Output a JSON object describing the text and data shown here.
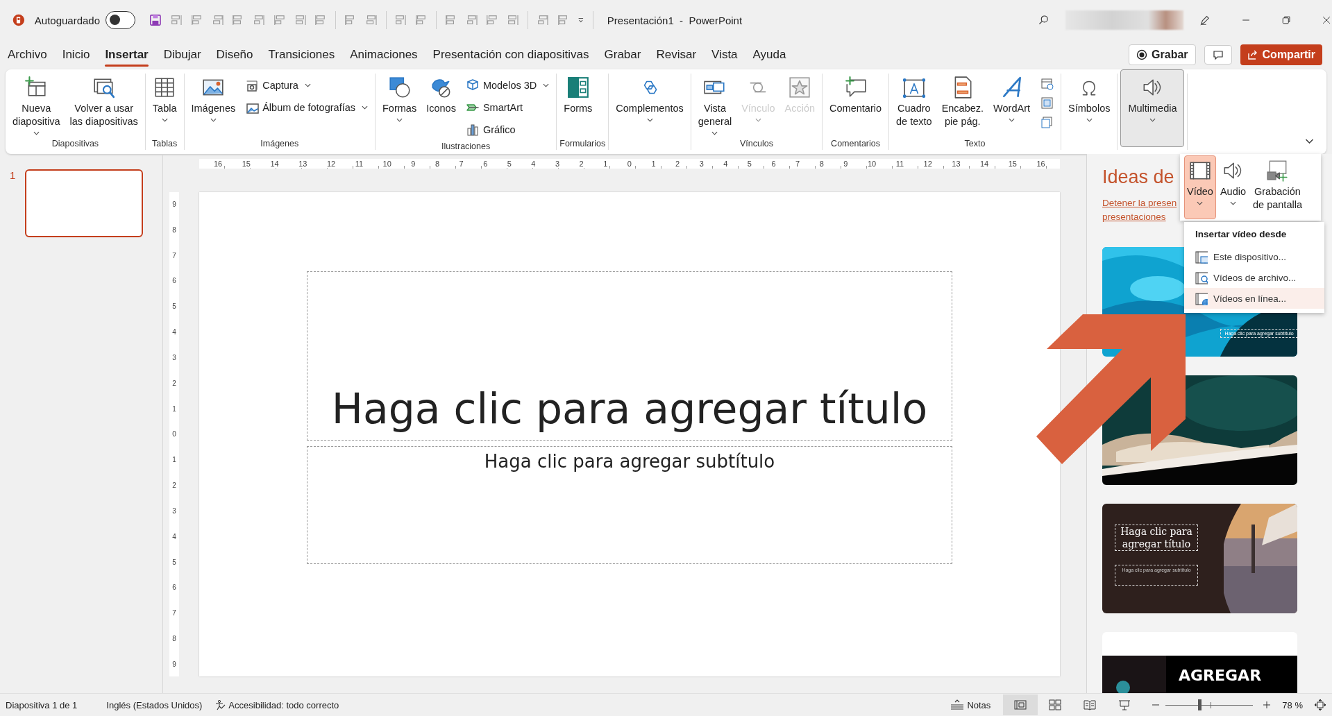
{
  "title_bar": {
    "autosave": {
      "label": "Autoguardado",
      "on": false
    },
    "document_title": "Presentación1  -  PowerPoint"
  },
  "menu_tabs": [
    {
      "label": "Archivo",
      "selected": false
    },
    {
      "label": "Inicio",
      "selected": false
    },
    {
      "label": "Insertar",
      "selected": true
    },
    {
      "label": "Dibujar",
      "selected": false
    },
    {
      "label": "Diseño",
      "selected": false
    },
    {
      "label": "Transiciones",
      "selected": false
    },
    {
      "label": "Animaciones",
      "selected": false
    },
    {
      "label": "Presentación con diapositivas",
      "selected": false
    },
    {
      "label": "Grabar",
      "selected": false
    },
    {
      "label": "Revisar",
      "selected": false
    },
    {
      "label": "Vista",
      "selected": false
    },
    {
      "label": "Ayuda",
      "selected": false
    }
  ],
  "actions": {
    "record": "Grabar",
    "share": "Compartir"
  },
  "ribbon": {
    "groups": [
      {
        "label": "Diapositivas",
        "items": [
          {
            "kind": "large",
            "label": "Nueva\ndiapositiva",
            "dropdown": true,
            "disabled": false,
            "expanded": false
          },
          {
            "kind": "large",
            "label": "Volver a usar\nlas diapositivas",
            "dropdown": false,
            "disabled": false,
            "expanded": false
          }
        ]
      },
      {
        "label": "Tablas",
        "items": [
          {
            "kind": "large",
            "label": "Tabla",
            "dropdown": true,
            "disabled": false,
            "expanded": false
          }
        ]
      },
      {
        "label": "Imágenes",
        "items": [
          {
            "kind": "large",
            "label": "Imágenes",
            "dropdown": true,
            "disabled": false,
            "expanded": false
          },
          {
            "kind": "stack",
            "items": [
              {
                "kind": "small",
                "label": "Captura",
                "dropdown": true,
                "disabled": false
              },
              {
                "kind": "small",
                "label": "Álbum de fotografías",
                "dropdown": true,
                "disabled": false
              }
            ]
          }
        ]
      },
      {
        "label": "Ilustraciones",
        "items": [
          {
            "kind": "large",
            "label": "Formas",
            "dropdown": true,
            "disabled": false,
            "expanded": false
          },
          {
            "kind": "large",
            "label": "Iconos",
            "dropdown": false,
            "disabled": false,
            "expanded": false
          },
          {
            "kind": "stack",
            "items": [
              {
                "kind": "small",
                "label": "Modelos 3D",
                "dropdown": true,
                "disabled": false
              },
              {
                "kind": "small",
                "label": "SmartArt",
                "dropdown": false,
                "disabled": false
              },
              {
                "kind": "small",
                "label": "Gráfico",
                "dropdown": false,
                "disabled": false
              }
            ]
          }
        ]
      },
      {
        "label": "Formularios",
        "items": [
          {
            "kind": "large",
            "label": "Forms",
            "dropdown": false,
            "disabled": false,
            "expanded": false
          }
        ]
      },
      {
        "items": [
          {
            "kind": "large",
            "label": "Complementos",
            "dropdown": true,
            "disabled": false,
            "expanded": false
          }
        ]
      },
      {
        "label": "Vínculos",
        "items": [
          {
            "kind": "large",
            "label": "Vista\ngeneral",
            "dropdown": true,
            "disabled": false,
            "expanded": false
          },
          {
            "kind": "large",
            "label": "Vínculo",
            "dropdown": true,
            "disabled": true,
            "expanded": false
          },
          {
            "kind": "large",
            "label": "Acción",
            "dropdown": false,
            "disabled": true,
            "expanded": false
          }
        ]
      },
      {
        "label": "Comentarios",
        "items": [
          {
            "kind": "large",
            "label": "Comentario",
            "dropdown": false,
            "disabled": false,
            "expanded": false
          }
        ]
      },
      {
        "label": "Texto",
        "items": [
          {
            "kind": "large",
            "label": "Cuadro\nde texto",
            "dropdown": false,
            "disabled": false,
            "expanded": false
          },
          {
            "kind": "large",
            "label": "Encabez.\npie pág.",
            "dropdown": false,
            "disabled": false,
            "expanded": false
          },
          {
            "kind": "large",
            "label": "WordArt",
            "dropdown": true,
            "disabled": false,
            "expanded": false
          },
          {
            "kind": "stack",
            "items": [
              {
                "kind": "icon",
                "disabled": false
              },
              {
                "kind": "icon",
                "disabled": false
              },
              {
                "kind": "icon",
                "disabled": false
              }
            ]
          }
        ]
      },
      {
        "items": [
          {
            "kind": "large",
            "label": "Símbolos",
            "dropdown": true,
            "disabled": false,
            "expanded": false
          }
        ]
      },
      {
        "items": [
          {
            "kind": "large",
            "label": "Multimedia",
            "dropdown": true,
            "disabled": false,
            "expanded": true
          }
        ]
      }
    ]
  },
  "media_flyout": {
    "items": [
      {
        "kind": "video",
        "label": "Vídeo",
        "dropdown": true,
        "selected": true
      },
      {
        "kind": "audio",
        "label": "Audio",
        "dropdown": true,
        "selected": false
      },
      {
        "kind": "screen",
        "label": "Grabación\nde pantalla",
        "dropdown": false,
        "selected": false
      }
    ]
  },
  "video_menu": {
    "header": "Insertar vídeo desde",
    "items": [
      {
        "kind": "device",
        "label": "Este dispositivo...",
        "selected": false
      },
      {
        "kind": "stock",
        "label": "Vídeos de archivo...",
        "selected": false
      },
      {
        "kind": "online",
        "label": "Vídeos en línea...",
        "selected": true
      }
    ]
  },
  "ruler": {
    "horizontal": [
      "16",
      "15",
      "14",
      "13",
      "12",
      "11",
      "10",
      "9",
      "8",
      "7",
      "6",
      "5",
      "4",
      "3",
      "2",
      "1",
      "0",
      "1",
      "2",
      "3",
      "4",
      "5",
      "6",
      "7",
      "8",
      "9",
      "10",
      "11",
      "12",
      "13",
      "14",
      "15",
      "16"
    ],
    "vertical": [
      "9",
      "8",
      "7",
      "6",
      "5",
      "4",
      "3",
      "2",
      "1",
      "0",
      "1",
      "2",
      "3",
      "4",
      "5",
      "6",
      "7",
      "8",
      "9"
    ]
  },
  "slides": [
    {
      "number": "1",
      "selected": true
    }
  ],
  "slide": {
    "title": "Haga clic para agregar título",
    "subtitle": "Haga clic para agregar subtítulo"
  },
  "designer": {
    "title": "Ideas de",
    "link_lines": [
      "Detener la presen",
      "presentaciones"
    ],
    "thumbnails": [
      {
        "kind": "water",
        "subtitle": "Haga clic para agregar subtítulo"
      },
      {
        "kind": "books"
      },
      {
        "kind": "pipeline",
        "title": "Haga clic para agregar título",
        "subtitle": "Haga clic para agregar subtítulo"
      },
      {
        "kind": "space",
        "title": "AGREGAR"
      }
    ]
  },
  "status_bar": {
    "slide_info": "Diapositiva 1 de 1",
    "language": "Inglés (Estados Unidos)",
    "accessibility": "Accesibilidad: todo correcto",
    "notes": "Notas",
    "views": [
      {
        "kind": "normal",
        "selected": true
      },
      {
        "kind": "sorter",
        "selected": false
      },
      {
        "kind": "reading",
        "selected": false
      },
      {
        "kind": "slideshow",
        "selected": false
      }
    ],
    "zoom": {
      "level": 0.39,
      "reading": "78 %"
    }
  }
}
